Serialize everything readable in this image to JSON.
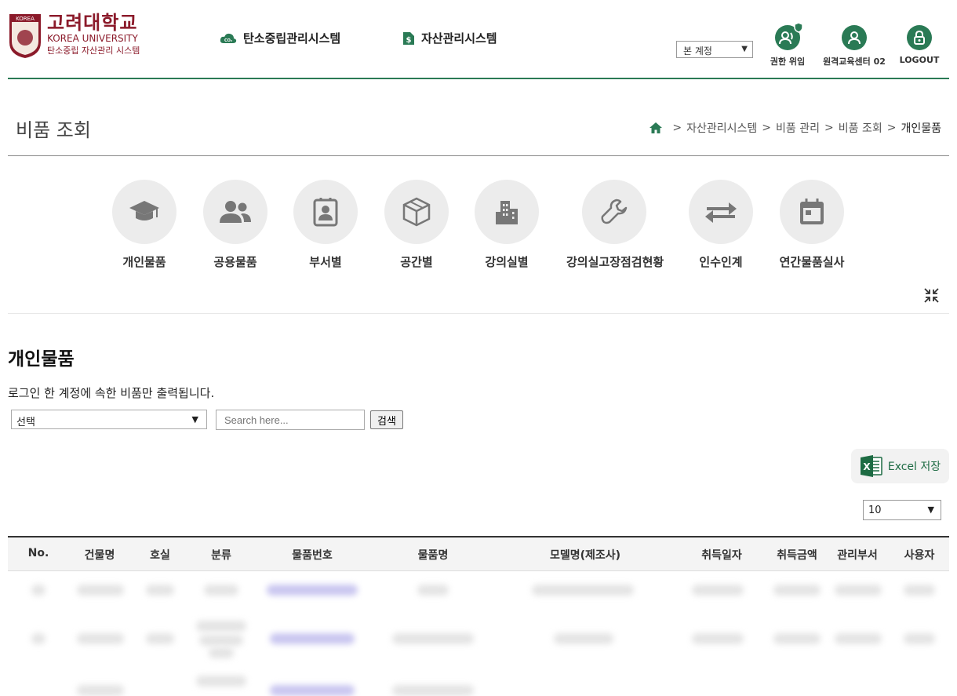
{
  "header": {
    "logo_kr": "고려대학교",
    "logo_en": "KOREA UNIVERSITY",
    "logo_sub": "탄소중립 자산관리 시스템",
    "crest_text": "KOREA",
    "nav_items": [
      {
        "label": "탄소중립관리시스템",
        "icon": "co2-cloud-icon"
      },
      {
        "label": "자산관리시스템",
        "icon": "dollar-document-icon"
      }
    ],
    "account_select": "본 계정",
    "tools": [
      {
        "label": "권한 위임",
        "icon": "users-shield-icon"
      },
      {
        "label": "원격교육센터 02",
        "icon": "user-icon"
      },
      {
        "label": "LOGOUT",
        "icon": "lock-icon"
      }
    ],
    "brand_color": "#2a7a55",
    "logo_color": "#8b1a2a"
  },
  "page": {
    "title": "비품 조회",
    "breadcrumb": [
      "자산관리시스템",
      "비품 관리",
      "비품 조회",
      "개인물품"
    ],
    "breadcrumb_sep": ">"
  },
  "categories": [
    {
      "label": "개인물품",
      "icon": "graduation-cap-icon"
    },
    {
      "label": "공용물품",
      "icon": "users-icon"
    },
    {
      "label": "부서별",
      "icon": "id-badge-icon"
    },
    {
      "label": "공간별",
      "icon": "cube-icon"
    },
    {
      "label": "강의실별",
      "icon": "building-icon"
    },
    {
      "label": "강의실고장점검현황",
      "icon": "wrench-icon"
    },
    {
      "label": "인수인계",
      "icon": "exchange-icon"
    },
    {
      "label": "연간물품실사",
      "icon": "calendar-icon"
    }
  ],
  "section": {
    "title": "개인물품",
    "notice": "로그인 한 계정에 속한 비품만 출력됩니다.",
    "filter_value": "선택",
    "search_placeholder": "Search here...",
    "search_button": "검색",
    "excel_button": "Excel 저장",
    "page_size": "10"
  },
  "table": {
    "headers": [
      "No.",
      "건물명",
      "호실",
      "분류",
      "물품번호",
      "물품명",
      "모델명(제조사)",
      "취득일자",
      "취득금액",
      "관리부서",
      "사용자"
    ]
  }
}
